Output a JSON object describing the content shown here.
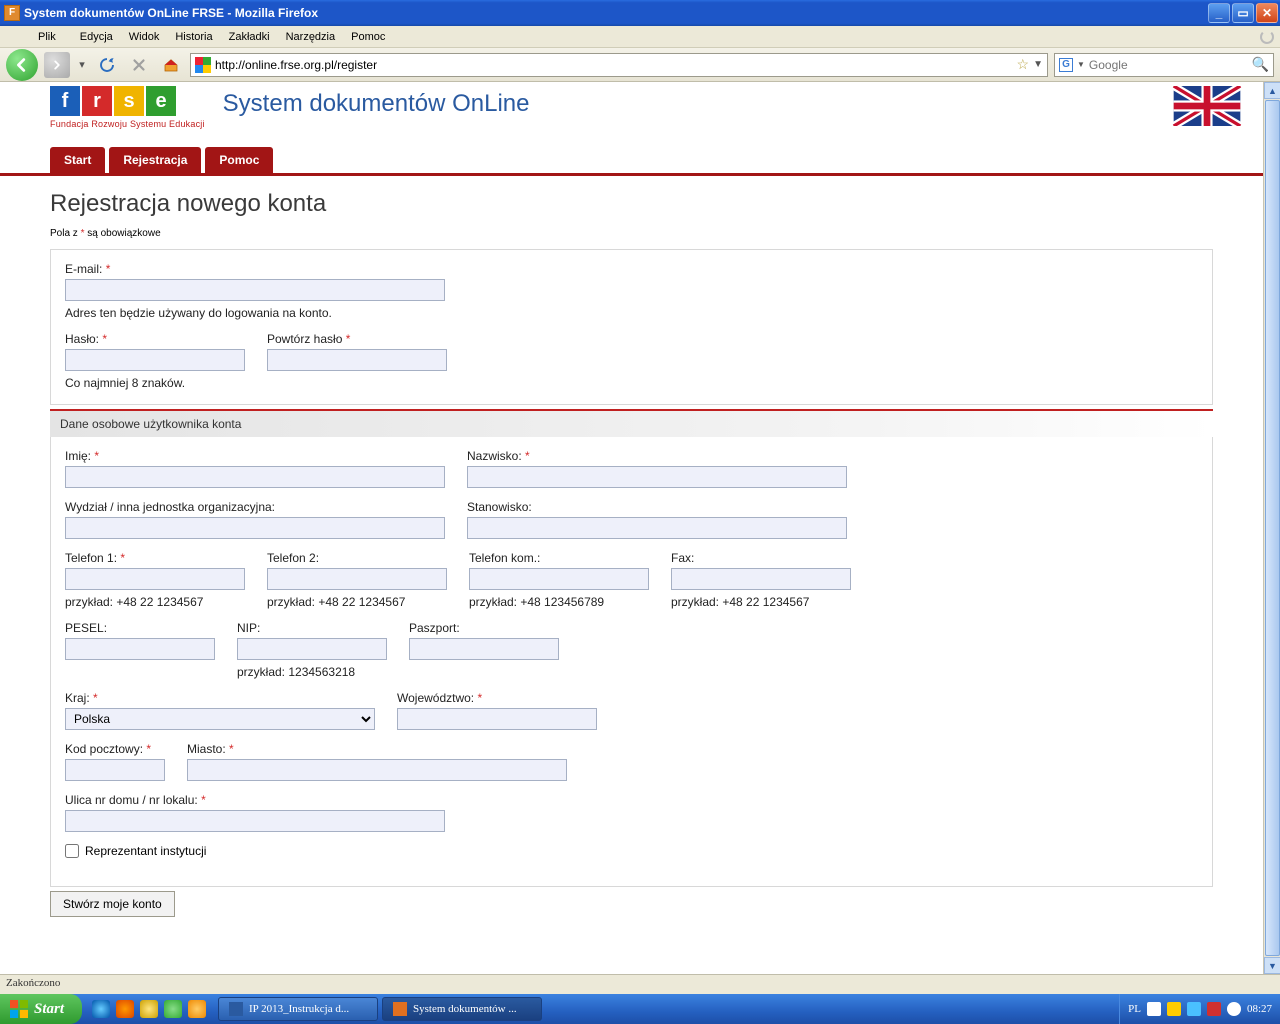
{
  "window": {
    "title": "System dokumentów OnLine FRSE - Mozilla Firefox"
  },
  "menubar": [
    "Plik",
    "Edycja",
    "Widok",
    "Historia",
    "Zakładki",
    "Narzędzia",
    "Pomoc"
  ],
  "url": "http://online.frse.org.pl/register",
  "search_placeholder": "Google",
  "page": {
    "logo_sub": "Fundacja Rozwoju Systemu Edukacji",
    "systitle": "System dokumentów OnLine",
    "tabs": [
      "Start",
      "Rejestracja",
      "Pomoc"
    ],
    "h1": "Rejestracja nowego konta",
    "req_note_pre": "Pola z ",
    "req_note_post": " są obowiązkowe",
    "section2_title": "Dane osobowe użytkownika konta",
    "labels": {
      "email": "E-mail:",
      "email_hint": "Adres ten będzie używany do logowania na konto.",
      "pass": "Hasło:",
      "pass2": "Powtórz hasło",
      "pass_hint": "Co najmniej 8 znaków.",
      "imie": "Imię:",
      "nazwisko": "Nazwisko:",
      "wydzial": "Wydział / inna jednostka organizacyjna:",
      "stanowisko": "Stanowisko:",
      "tel1": "Telefon 1:",
      "tel2": "Telefon 2:",
      "telkom": "Telefon kom.:",
      "fax": "Fax:",
      "tel1_hint": "przykład: +48 22 1234567",
      "tel2_hint": "przykład: +48 22 1234567",
      "telkom_hint": "przykład: +48 123456789",
      "fax_hint": "przykład: +48 22 1234567",
      "pesel": "PESEL:",
      "nip": "NIP:",
      "nip_hint": "przykład: 1234563218",
      "paszport": "Paszport:",
      "kraj": "Kraj:",
      "woj": "Województwo:",
      "kod": "Kod pocztowy:",
      "miasto": "Miasto:",
      "ulica": "Ulica nr domu / nr lokalu:",
      "repr": "Reprezentant instytucji"
    },
    "kraj_value": "Polska",
    "submit": "Stwórz moje konto"
  },
  "statusbar": "Zakończono",
  "taskbar": {
    "start": "Start",
    "task1": "IP 2013_Instrukcja d...",
    "task2": "System dokumentów ...",
    "lang": "PL",
    "clock": "08:27"
  }
}
